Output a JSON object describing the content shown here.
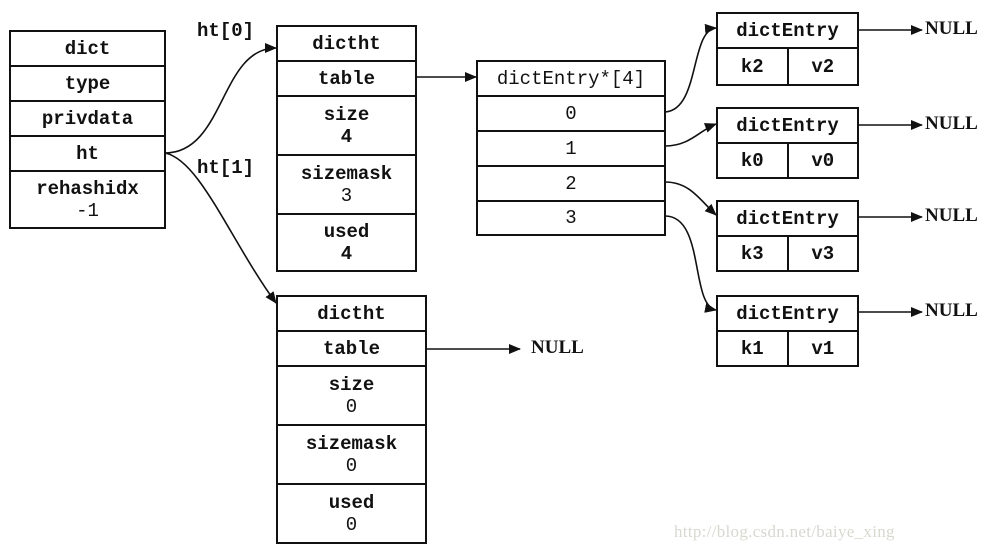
{
  "dict": {
    "title": "dict",
    "fields": [
      "type",
      "privdata",
      "ht"
    ],
    "rehashidx_label": "rehashidx",
    "rehashidx_value": "-1"
  },
  "links": {
    "ht0": "ht[0]",
    "ht1": "ht[1]"
  },
  "ht0": {
    "title": "dictht",
    "table": "table",
    "size_label": "size",
    "size_value": "4",
    "sizemask_label": "sizemask",
    "sizemask_value": "3",
    "used_label": "used",
    "used_value": "4"
  },
  "ht1": {
    "title": "dictht",
    "table": "table",
    "table_target": "NULL",
    "size_label": "size",
    "size_value": "0",
    "sizemask_label": "sizemask",
    "sizemask_value": "0",
    "used_label": "used",
    "used_value": "0"
  },
  "bucket_array": {
    "title": "dictEntry*[4]",
    "slots": [
      "0",
      "1",
      "2",
      "3"
    ]
  },
  "entries": [
    {
      "title": "dictEntry",
      "key": "k2",
      "value": "v2",
      "next": "NULL",
      "slot": "0"
    },
    {
      "title": "dictEntry",
      "key": "k0",
      "value": "v0",
      "next": "NULL",
      "slot": "1"
    },
    {
      "title": "dictEntry",
      "key": "k3",
      "value": "v3",
      "next": "NULL",
      "slot": "2"
    },
    {
      "title": "dictEntry",
      "key": "k1",
      "value": "v1",
      "next": "NULL",
      "slot": "3"
    }
  ],
  "watermark": "http://blog.csdn.net/baiye_xing"
}
